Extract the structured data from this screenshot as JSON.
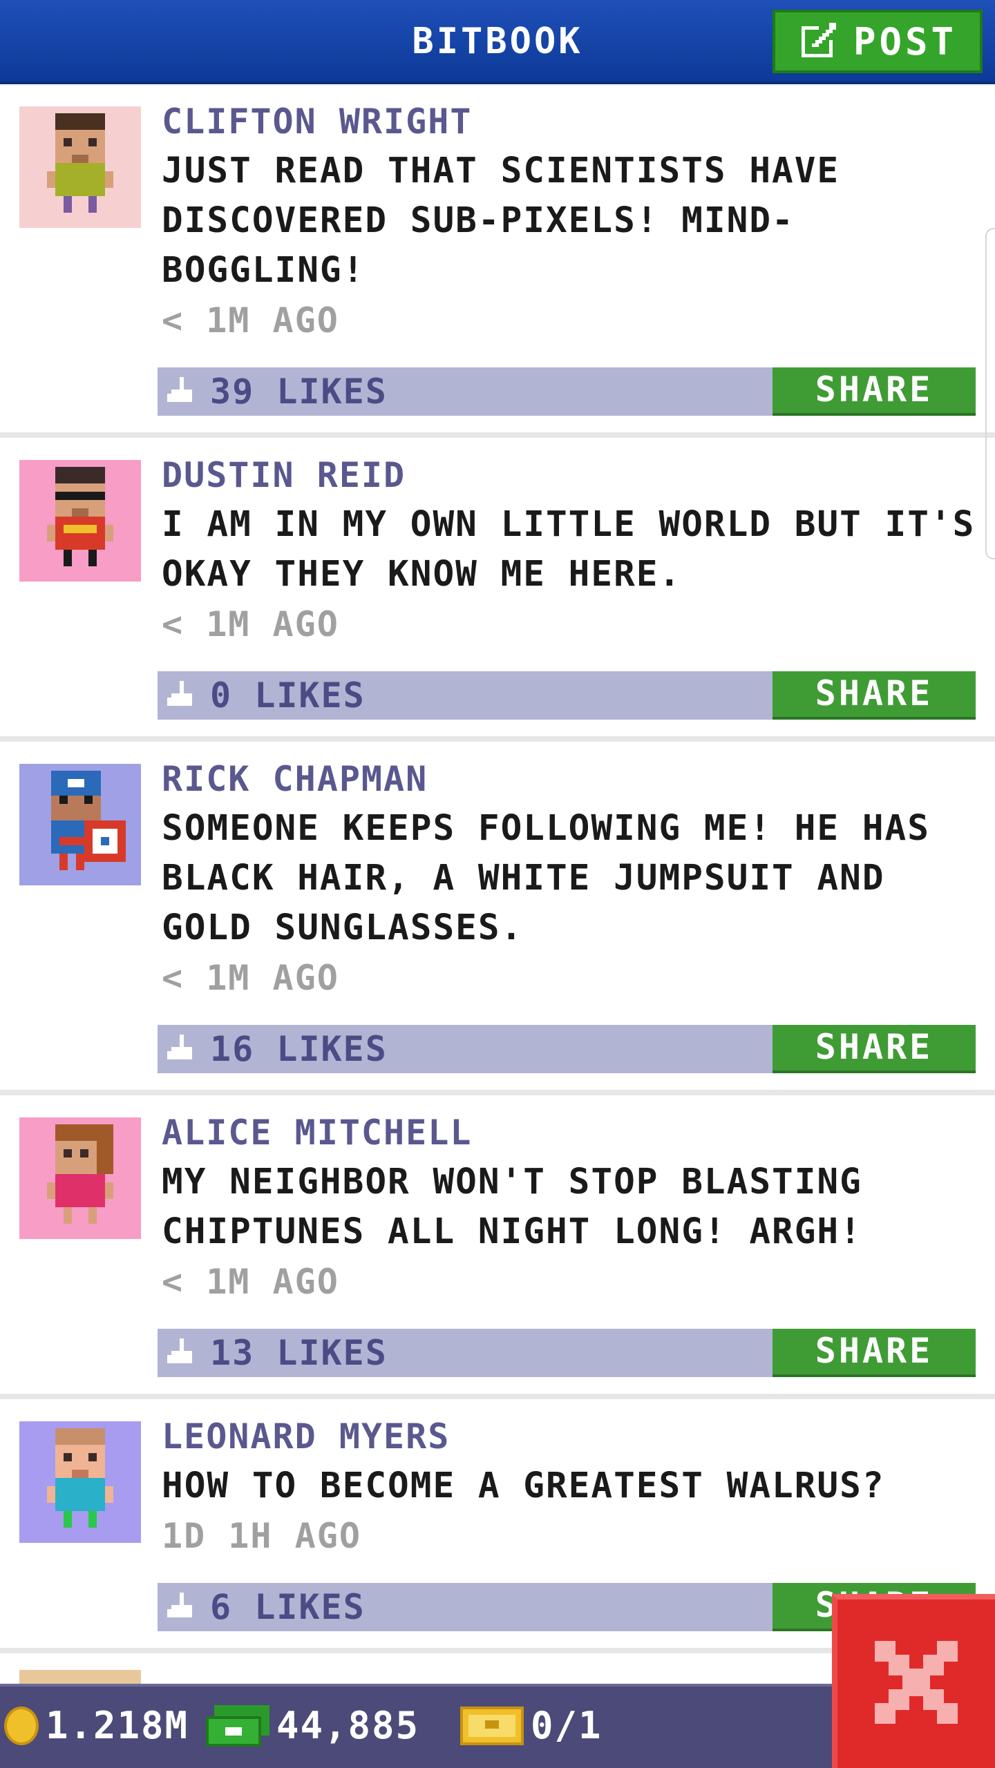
{
  "header": {
    "title": "BITBOOK",
    "post_label": "POST"
  },
  "posts": [
    {
      "author": "CLIFTON WRIGHT",
      "message": "JUST READ THAT SCIENTISTS HAVE DISCOVERED SUB-PIXELS! MIND-BOGGLING!",
      "time": "< 1M AGO",
      "likes": "39 LIKES",
      "share_label": "SHARE",
      "avatar_bg": "#f6d0d0"
    },
    {
      "author": "DUSTIN REID",
      "message": "I AM IN MY OWN LITTLE WORLD BUT IT'S OKAY THEY KNOW ME HERE.",
      "time": "< 1M AGO",
      "likes": "0 LIKES",
      "share_label": "SHARE",
      "avatar_bg": "#f79dc6"
    },
    {
      "author": "RICK CHAPMAN",
      "message": "SOMEONE KEEPS FOLLOWING ME! HE HAS BLACK HAIR, A WHITE JUMPSUIT AND GOLD SUNGLASSES.",
      "time": "< 1M AGO",
      "likes": "16 LIKES",
      "share_label": "SHARE",
      "avatar_bg": "#9fa0e6"
    },
    {
      "author": "ALICE MITCHELL",
      "message": "MY NEIGHBOR WON'T STOP BLASTING CHIPTUNES ALL NIGHT LONG! ARGH!",
      "time": "< 1M AGO",
      "likes": "13 LIKES",
      "share_label": "SHARE",
      "avatar_bg": "#f79dc6"
    },
    {
      "author": "LEONARD MYERS",
      "message": "HOW TO BECOME A GREATEST WALRUS?",
      "time": "1D 1H AGO",
      "likes": "6 LIKES",
      "share_label": "SHARE",
      "avatar_bg": "#a79cf0"
    }
  ],
  "status": {
    "coins": "1.218M",
    "bux": "44,885",
    "vip": "0/1"
  },
  "colors": {
    "header_blue": "#1f4fb8",
    "share_green": "#3f9c35",
    "likes_bar": "#b2b4d4",
    "close_red": "#e02a2a"
  },
  "icons": {
    "post": "edit-icon",
    "like": "thumbs-up-icon",
    "coin": "coin-icon",
    "bux": "bux-icon",
    "vip": "vip-ticket-icon",
    "close": "close-icon"
  }
}
